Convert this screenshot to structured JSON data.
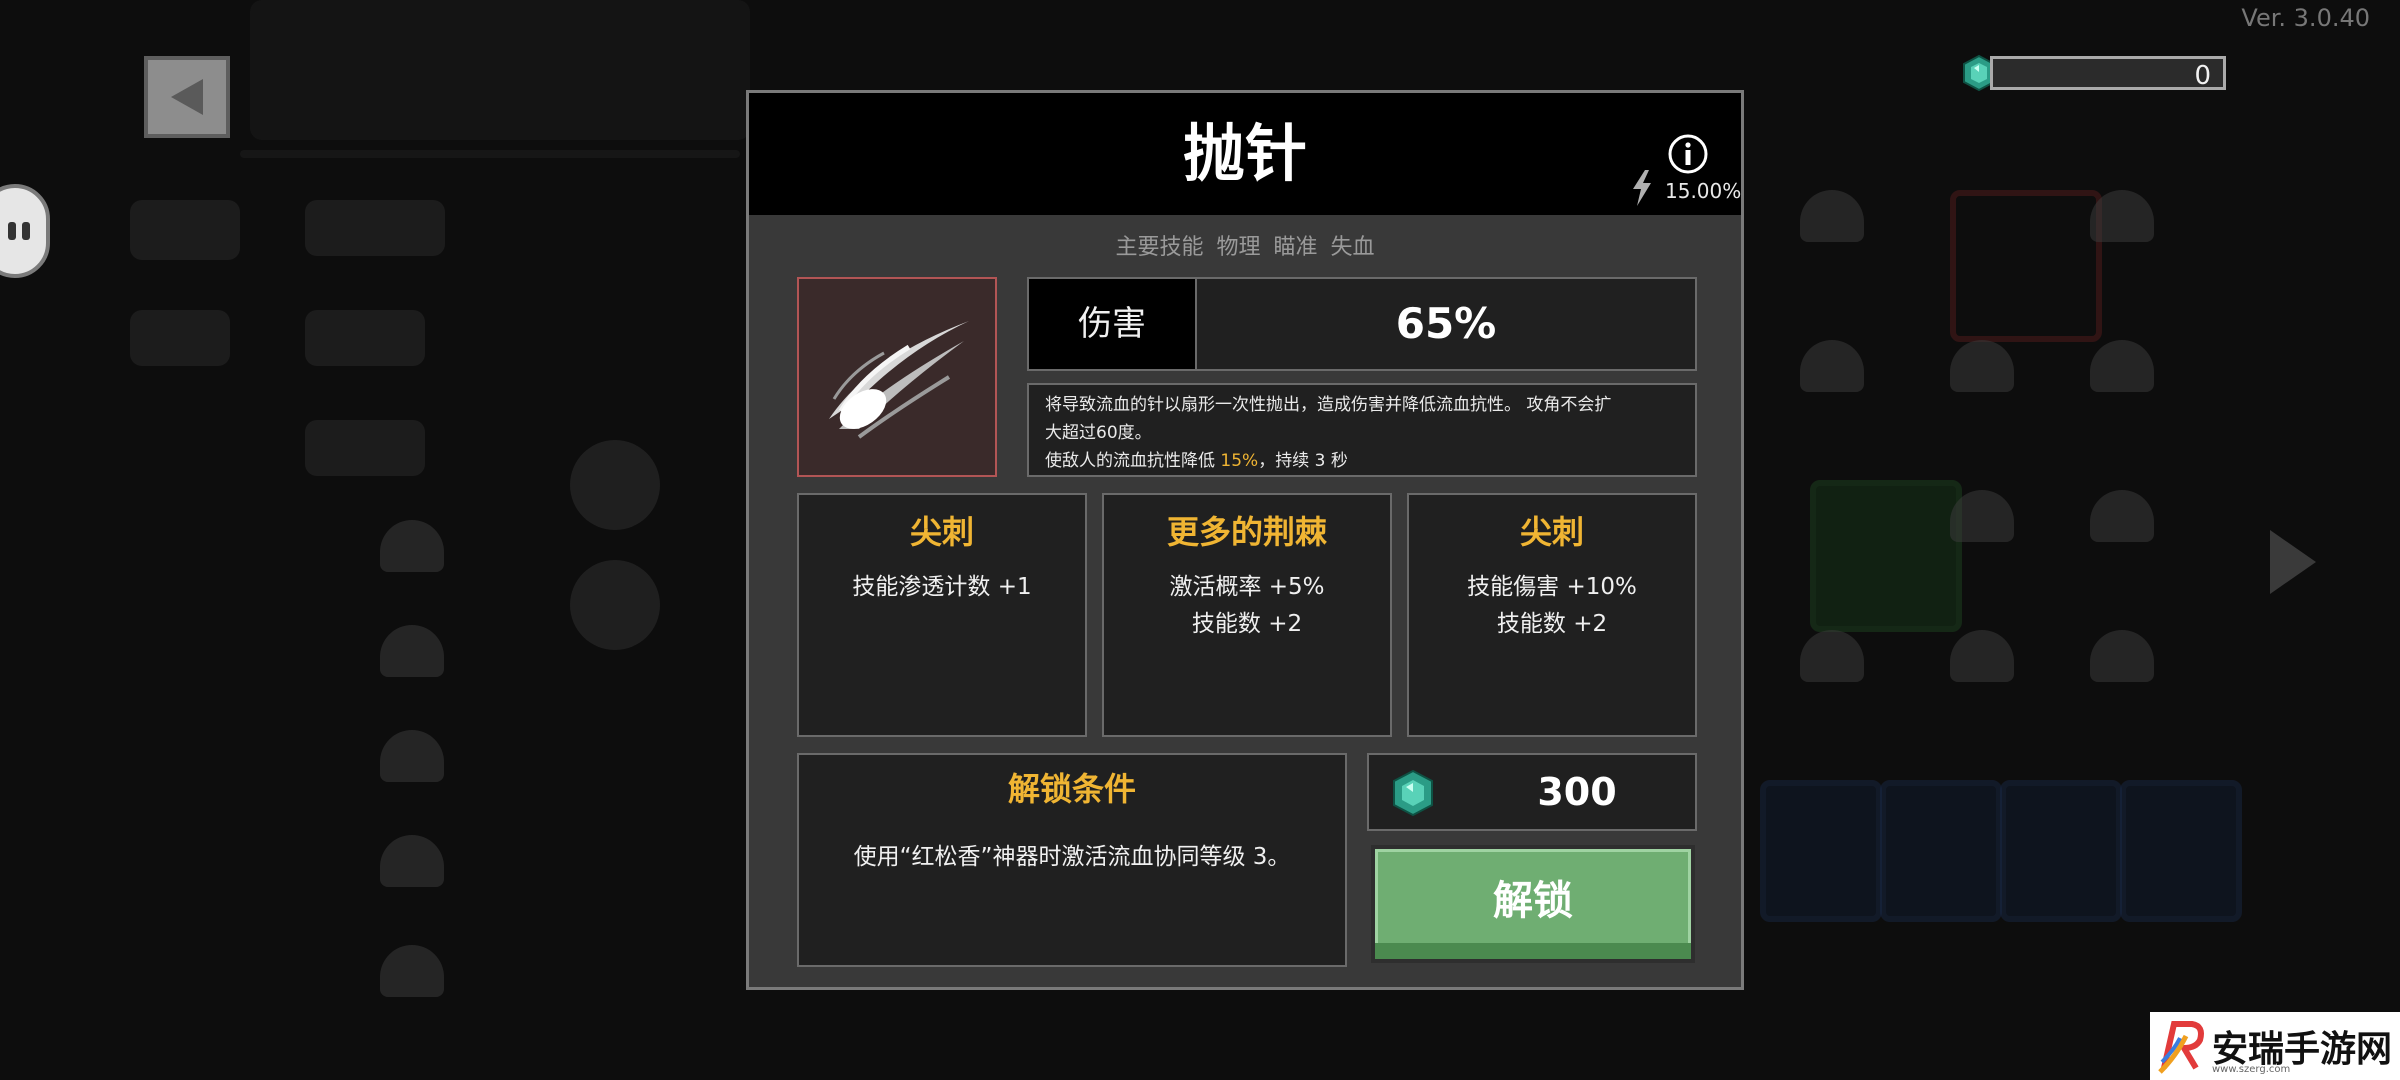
{
  "version": "Ver. 3.0.40",
  "currency": {
    "amount": "0",
    "icon": "green-gem-icon"
  },
  "modal": {
    "title": "抛针",
    "crit_chance": "15.00%",
    "tags": "主要技能 物理 瞄准 失血",
    "damage": {
      "label": "伤害",
      "value": "65%"
    },
    "description": {
      "line1": "将导致流血的针以扇形一次性抛出，造成伤害并降低流血抗性。 攻角不会扩",
      "line2": "大超过60度。",
      "line3_prefix": "使敌人的流血抗性降低 ",
      "line3_highlight": "15%",
      "line3_suffix": "，持续 3 秒"
    },
    "upgrades": [
      {
        "title": "尖刺",
        "lines": [
          "技能渗透计数 +1"
        ]
      },
      {
        "title": "更多的荆棘",
        "lines": [
          "激活概率 +5%",
          "技能数 +2"
        ]
      },
      {
        "title": "尖刺",
        "lines": [
          "技能傷害 +10%",
          "技能数 +2"
        ]
      }
    ],
    "unlock_condition": {
      "title": "解锁条件",
      "text": "使用“红松香”神器时激活流血协同等级 3。"
    },
    "cost": "300",
    "unlock_button": "解锁"
  },
  "watermark": {
    "text": "安瑞手游网",
    "url": "www.szerg.com"
  },
  "colors": {
    "accent_gold": "#f0b533",
    "unlock_green": "#6fae72",
    "panel": "#393939"
  }
}
